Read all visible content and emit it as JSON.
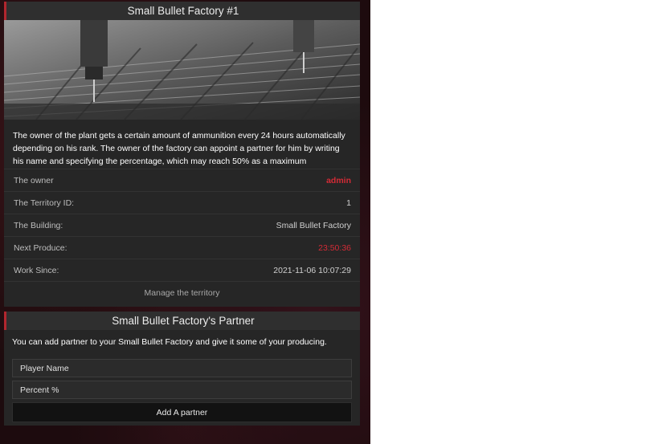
{
  "factory": {
    "title": "Small Bullet Factory #1",
    "hero_image": "cnc-machine-photo",
    "description": "The owner of the plant gets a certain amount of ammunition every 24 hours automatically depending on his rank. The owner of the factory can appoint a partner for him by writing his name and specifying the percentage, which may reach 50% as a maximum",
    "details": [
      {
        "label": "The owner",
        "value": "admin"
      },
      {
        "label": "The Territory ID:",
        "value": "1"
      },
      {
        "label": "The Building:",
        "value": "Small Bullet Factory"
      },
      {
        "label": "Next Produce:",
        "value": "23:50:36"
      },
      {
        "label": "Work Since:",
        "value": "2021-11-06 10:07:29"
      }
    ],
    "manage_label": "Manage the territory"
  },
  "partner": {
    "title": "Small Bullet Factory's Partner",
    "text": "You can add partner to your Small Bullet Factory and give it some of your producing.",
    "player_placeholder": "Player Name",
    "percent_placeholder": "Percent %",
    "add_label": "Add A partner"
  },
  "colors": {
    "accent_red": "#d42b36",
    "panel_bg": "#262626",
    "page_bg": "#1d0b0e"
  }
}
